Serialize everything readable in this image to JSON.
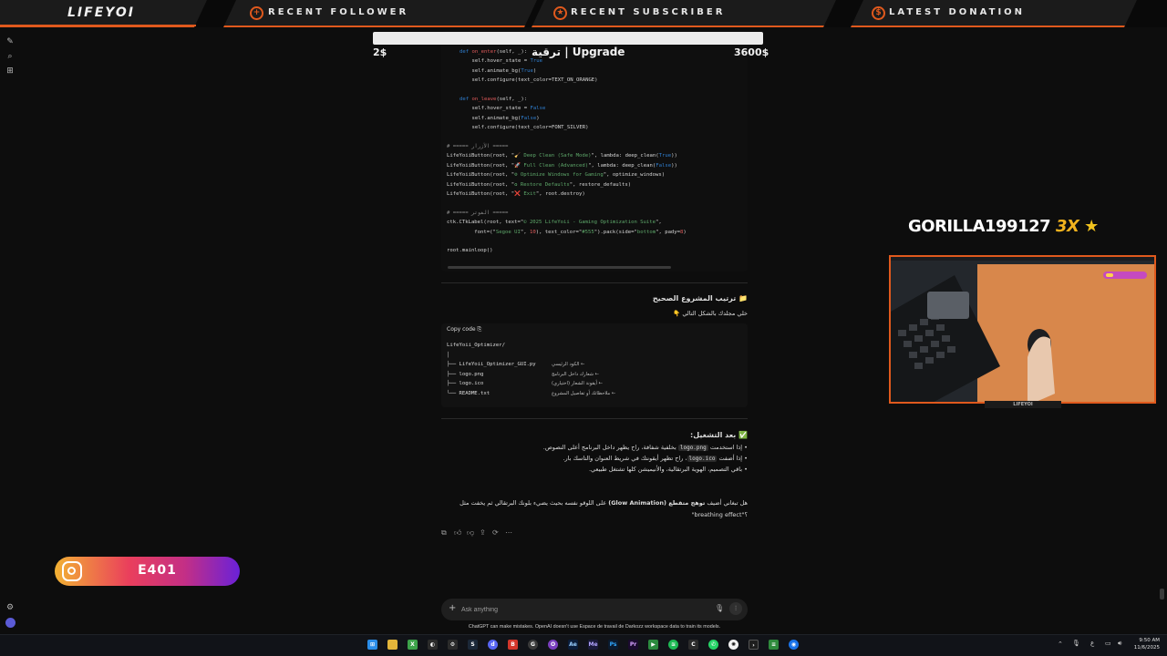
{
  "overlay": {
    "logo": "LIFEYOI",
    "recent_follower": "RECENT FOLLOWER",
    "recent_subscriber": "RECENT SUBSCRIBER",
    "latest_donation": "LATEST DONATION",
    "donation_min": "2$",
    "donation_title": "ترقية | Upgrade",
    "donation_max": "3600$",
    "gorilla_name": "GORILLA199127",
    "gorilla_mult": "3X",
    "instagram_handle": "E401"
  },
  "code": {
    "lines": [
      {
        "parts": [
          [
            "kw",
            "def "
          ],
          [
            "fn",
            "on_enter"
          ],
          [
            "",
            "(self, _):"
          ]
        ]
      },
      {
        "parts": [
          [
            "",
            "    self.hover_state = "
          ],
          [
            "kw",
            "True"
          ]
        ]
      },
      {
        "parts": [
          [
            "",
            "    self.animate_bg("
          ],
          [
            "kw",
            "True"
          ],
          [
            "",
            ")"
          ]
        ]
      },
      {
        "parts": [
          [
            "",
            "    self.configure(text_color=TEXT_ON_ORANGE)"
          ]
        ]
      },
      {
        "parts": [
          [
            "",
            ""
          ]
        ]
      },
      {
        "parts": [
          [
            "kw",
            "def "
          ],
          [
            "fn",
            "on_leave"
          ],
          [
            "",
            "(self, _):"
          ]
        ]
      },
      {
        "parts": [
          [
            "",
            "    self.hover_state = "
          ],
          [
            "kw",
            "False"
          ]
        ]
      },
      {
        "parts": [
          [
            "",
            "    self.animate_bg("
          ],
          [
            "kw",
            "False"
          ],
          [
            "",
            ")"
          ]
        ]
      },
      {
        "parts": [
          [
            "",
            "    self.configure(text_color=FONT_SILVER)"
          ]
        ]
      }
    ],
    "lines2": [
      {
        "parts": [
          [
            "cm",
            "# ===== الأزرار ====="
          ]
        ]
      },
      {
        "parts": [
          [
            "",
            "LifeYoiiButton(root, \""
          ],
          [
            "str",
            "🧹 Deep Clean (Safe Mode)"
          ],
          [
            "",
            "\", lambda: deep_clean("
          ],
          [
            "kw",
            "True"
          ],
          [
            "",
            "))"
          ]
        ]
      },
      {
        "parts": [
          [
            "",
            "LifeYoiiButton(root, \""
          ],
          [
            "str",
            "🚀 Full Clean (Advanced)"
          ],
          [
            "",
            "\", lambda: deep_clean("
          ],
          [
            "kw",
            "False"
          ],
          [
            "",
            "))"
          ]
        ]
      },
      {
        "parts": [
          [
            "",
            "LifeYoiiButton(root, \""
          ],
          [
            "str",
            "⚙ Optimize Windows for Gaming"
          ],
          [
            "",
            "\", optimize_windows)"
          ]
        ]
      },
      {
        "parts": [
          [
            "",
            "LifeYoiiButton(root, \""
          ],
          [
            "str",
            "♻ Restore Defaults"
          ],
          [
            "",
            "\", restore_defaults)"
          ]
        ]
      },
      {
        "parts": [
          [
            "",
            "LifeYoiiButton(root, \""
          ],
          [
            "str",
            "❌ Exit"
          ],
          [
            "",
            "\", root.destroy)"
          ]
        ]
      },
      {
        "parts": [
          [
            "",
            ""
          ]
        ]
      },
      {
        "parts": [
          [
            "cm",
            "# ===== الفوتر ====="
          ]
        ]
      },
      {
        "parts": [
          [
            "",
            "ctk.CTkLabel(root, text=\""
          ],
          [
            "str",
            "© 2025 LifeYoii - Gaming Optimization Suite"
          ],
          [
            "",
            "\","
          ]
        ]
      },
      {
        "parts": [
          [
            "",
            "         font=(\""
          ],
          [
            "str",
            "Segoe UI"
          ],
          [
            "",
            "\", "
          ],
          [
            "num",
            "10"
          ],
          [
            "",
            "), text_color=\""
          ],
          [
            "str",
            "#555"
          ],
          [
            "",
            "\").pack(side=\""
          ],
          [
            "str",
            "bottom"
          ],
          [
            "",
            "\", pady="
          ],
          [
            "num",
            "8"
          ],
          [
            "",
            ")"
          ]
        ]
      },
      {
        "parts": [
          [
            "",
            ""
          ]
        ]
      },
      {
        "parts": [
          [
            "",
            "root.mainloop()"
          ]
        ]
      }
    ]
  },
  "project": {
    "heading": "📁 ترتيب المشروع الصحيح",
    "sub": "خلي مجلدك بالشكل التالي 👇",
    "copy_label": "Copy code ⎘",
    "tree": [
      {
        "path": "LifeYoii_Optimizer/",
        "note": ""
      },
      {
        "path": "│",
        "note": ""
      },
      {
        "path": "├── LifeYoii_Optimizer_GUI.py",
        "note": "← الكود الرئيسي"
      },
      {
        "path": "├── logo.png",
        "note": "← شعارك داخل البرنامج"
      },
      {
        "path": "├── logo.ico",
        "note": "← أيقونة الشعار (اختياري)"
      },
      {
        "path": "└── README.txt",
        "note": "← ملاحظاتك أو تفاصيل المشروع"
      }
    ]
  },
  "after_run": {
    "heading": "✅ بعد التشغيل:",
    "bullets": [
      [
        "إذا استخدمت ",
        "logo.png",
        " بخلفية شفافة، راح يظهر داخل البرنامج أعلى النصوص."
      ],
      [
        "إذا أضفت ",
        "logo.ico",
        "، راح تظهر أيقونتك في شريط العنوان والتاسك بار."
      ],
      [
        "باقي التصميم، الهوية البرتقالية، والأنيميشن كلها تشتغل طبيعي.",
        "",
        ""
      ]
    ]
  },
  "question": {
    "line1_pre": "هل تبغاني أضيف ",
    "line1_bold": "توهج متقطع (Glow Animation)",
    "line1_post": " على اللوقو نفسه بحيث يضيء بلونك البرتقالي ثم يخفت مثل",
    "line2": "؟\"breathing effect\""
  },
  "prompt": {
    "placeholder": "Ask anything",
    "disclaimer": "ChatGPT can make mistakes. OpenAI doesn't use Espace de travail de Darkozz workspace data to train its models."
  },
  "taskbar": {
    "time": "9:50 AM",
    "date": "11/6/2025",
    "lang": "ع"
  }
}
